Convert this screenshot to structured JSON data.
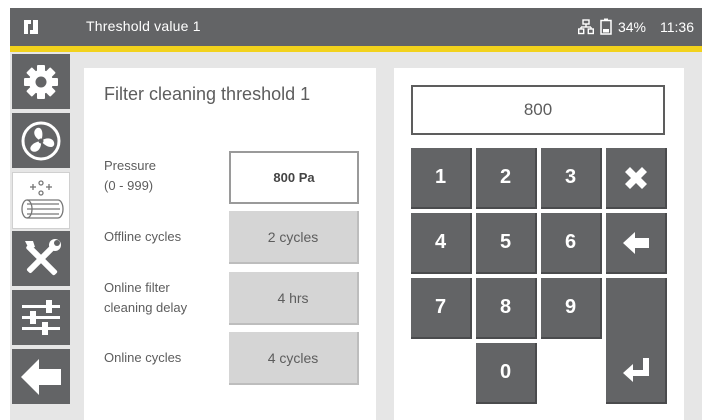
{
  "header": {
    "title": "Threshold value 1",
    "battery": "34%",
    "time": "11:36",
    "logo_icon": "company-logo",
    "network_icon": "network-icon",
    "battery_icon": "battery-icon"
  },
  "colors": {
    "header_bg": "#636466",
    "accent": "#f2d21d",
    "panel_bg": "#ffffff",
    "screen_bg": "#e6e6e6",
    "key_bg": "#636466",
    "value_box_bg": "#d5d5d5"
  },
  "sidebar": {
    "items": [
      {
        "icon": "gear-icon"
      },
      {
        "icon": "fan-icon"
      },
      {
        "icon": "filter-cleaning-icon",
        "active": true
      },
      {
        "icon": "tools-icon"
      },
      {
        "icon": "sliders-icon"
      },
      {
        "icon": "back-arrow-icon"
      }
    ]
  },
  "settings": {
    "title": "Filter cleaning threshold 1",
    "rows": [
      {
        "label_line1": "Pressure",
        "label_line2": "(0 - 999)",
        "value": "800 Pa"
      },
      {
        "label_line1": "Offline cycles",
        "value": "2 cycles"
      },
      {
        "label_line1": "Online filter",
        "label_line2": "cleaning delay",
        "value": "4 hrs"
      },
      {
        "label_line1": "Online cycles",
        "value": "4 cycles"
      }
    ]
  },
  "keypad": {
    "display": "800",
    "keys": [
      "1",
      "2",
      "3",
      "4",
      "5",
      "6",
      "7",
      "8",
      "9",
      "0"
    ],
    "clear_icon": "close-icon",
    "backspace_icon": "backspace-arrow-icon",
    "enter_icon": "enter-icon"
  }
}
